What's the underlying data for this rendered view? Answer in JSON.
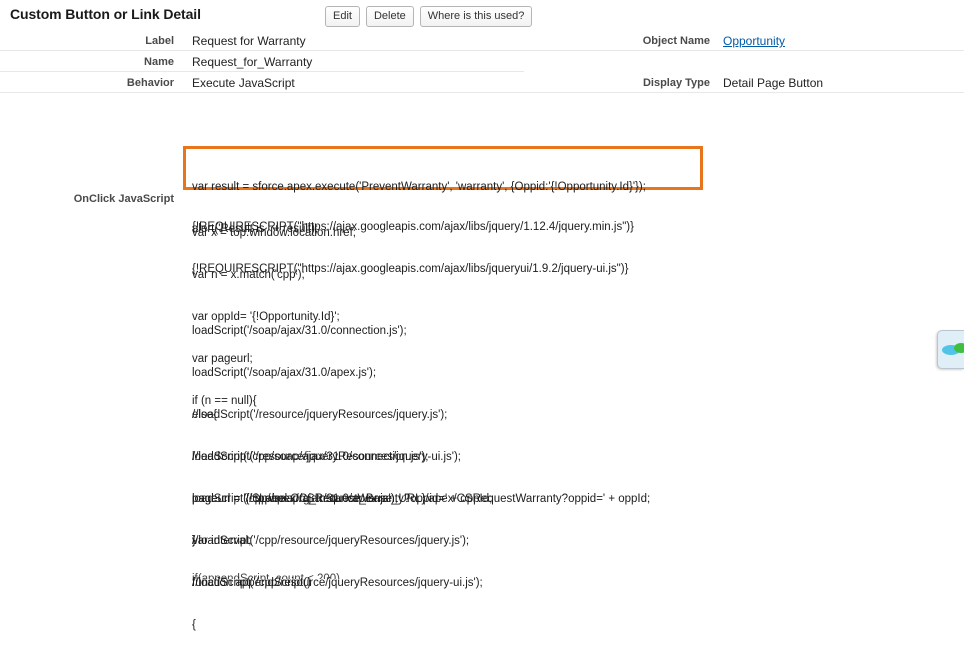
{
  "header": {
    "title": "Custom Button or Link Detail",
    "buttons": [
      {
        "label": "Edit",
        "name": "edit-button"
      },
      {
        "label": "Delete",
        "name": "delete-button"
      },
      {
        "label": "Where is this used?",
        "name": "where-is-this-used-button"
      }
    ]
  },
  "detail": {
    "label_field": {
      "label": "Label",
      "value": "Request for Warranty"
    },
    "name_field": {
      "label": "Name",
      "value": "Request_for_Warranty"
    },
    "behavior_field": {
      "label": "Behavior",
      "value": "Execute JavaScript"
    },
    "object_name_field": {
      "label": "Object Name",
      "value": "Opportunity"
    },
    "display_type_field": {
      "label": "Display Type",
      "value": "Detail Page Button"
    },
    "onclick_field": {
      "label": "OnClick JavaScript"
    }
  },
  "code": {
    "requires": [
      "{!REQUIRESCRIPT(\"https://ajax.googleapis.com/ajax/libs/jquery/1.12.4/jquery.min.js\")}",
      "{!REQUIRESCRIPT(\"https://ajax.googleapis.com/ajax/libs/jqueryui/1.9.2/jquery-ui.js\")}"
    ],
    "highlighted": [
      "var result = sforce.apex.execute('PreventWarranty', 'warranty', {Oppid:'{!Opportunity.Id}'});",
      "alert('Result is ' + result);"
    ],
    "group_vars": [
      "var x = top.window.location.href;",
      "var n = x.match('cpp');",
      "var oppId= '{!Opportunity.Id}';",
      "var pageurl;",
      "if (n == null){"
    ],
    "group_if_body": [
      "loadScript('/soap/ajax/31.0/connection.js');",
      "loadScript('/soap/ajax/31.0/apex.js');",
      "//loadScript('/resource/jqueryResources/jquery.js');",
      "//loadScript('/resource/jqueryResources/jquery-ui.js');",
      "pageurl = '{!$Label.Org_Instance_Base_URL}/apex/CSRequestWarranty?oppid=' + oppId;",
      "}"
    ],
    "group_else_body": [
      "else{",
      "loadScript('/cpp/soap/ajax/31.0/connection.js');",
      "loadScript('/cpp/soap/ajax/31.0/apex.js');",
      "//loadScript('/cpp/resource/jqueryResources/jquery.js');",
      "//loadScript('/cpp/resource/jqueryResources/jquery-ui.js');"
    ],
    "group_pageurl": [
      "pageurl = '/cpp/apex/CSRequestWarranty?oppid=' + oppId;",
      "}"
    ],
    "group_tail": [
      "var interval;",
      "function appendScript()",
      "{"
    ],
    "group_clipped": [
      "if(appendScript_count < 200)"
    ]
  },
  "colors": {
    "highlight_border": "#e8741c",
    "link": "#015ba7",
    "label_text": "#4a4a4a",
    "row_separator": "#e8e8e8"
  },
  "chat_widget": {
    "icon": "chat-support-icon"
  }
}
